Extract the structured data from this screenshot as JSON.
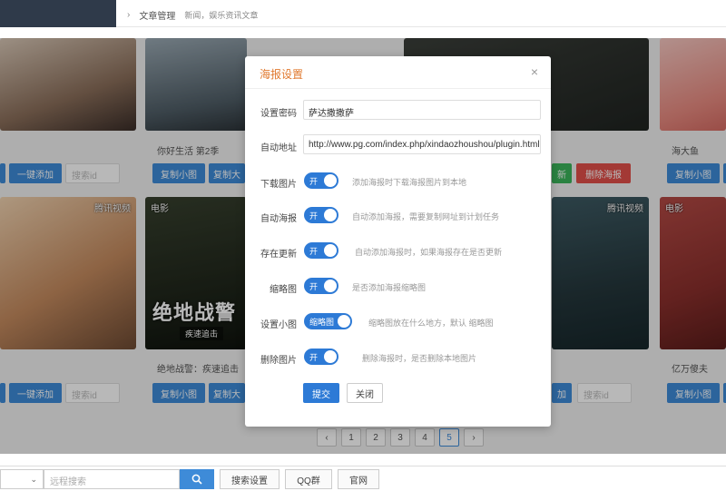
{
  "colors": {
    "accent": "#2d7ad6",
    "title": "#e0792f",
    "green": "#3bb55a",
    "red": "#e2504a"
  },
  "breadcrumb": {
    "chevron": "›",
    "item1": "文章管理",
    "item2": "新闻，娱乐资讯文章"
  },
  "cards": {
    "t1": "你好生活 第2季",
    "t2": "海大鱼",
    "t3": "绝地战警：疾速追击",
    "t4": "亿万傻夫",
    "tag_tencent": "腾讯视频",
    "tag_movie": "电影",
    "big_title": "绝地战警",
    "big_sub": "疾速追击",
    "btn_add": "一键添加",
    "btn_copy_small": "复制小图",
    "btn_copy_big": "复制大图",
    "btn_copy_big_short": "复制大",
    "btn_delete_poster": "删除海报",
    "btn_add_short": "加",
    "btn_green": "新",
    "ph_id": "搜索id"
  },
  "pager": {
    "prev": "‹",
    "next": "›",
    "pages": [
      "1",
      "2",
      "3",
      "4",
      "5"
    ],
    "active": "5"
  },
  "bottom": {
    "dropdown_arrow": "⌄",
    "search_placeholder": "远程搜索",
    "search_settings": "搜索设置",
    "qq_group": "QQ群",
    "website": "官网"
  },
  "modal": {
    "title": "海报设置",
    "close": "×",
    "fields": {
      "password_label": "设置密码",
      "password_value": "萨达撒撒萨",
      "autourl_label": "自动地址",
      "autourl_value": "http://www.pg.com/index.php/xindaozhoushou/plugin.html?plu",
      "download_label": "下载图片",
      "download_switch": "开",
      "download_hint": "添加海报时下载海报图片到本地",
      "autoposter_label": "自动海报",
      "autoposter_switch": "开",
      "autoposter_hint": "自动添加海报，需要复制网址到计划任务",
      "update_label": "存在更新",
      "update_switch": "开",
      "update_hint": "自动添加海报时，如果海报存在是否更新",
      "thumb_label": "缩略图",
      "thumb_switch": "开",
      "thumb_hint": "是否添加海报缩略图",
      "smallimg_label": "设置小图",
      "smallimg_switch": "缩略图",
      "smallimg_hint": "缩略图放在什么地方，默认 缩略图",
      "delimg_label": "删除图片",
      "delimg_switch": "开",
      "delimg_hint": "删除海报时，是否删除本地图片"
    },
    "submit": "提交",
    "cancel": "关闭"
  }
}
